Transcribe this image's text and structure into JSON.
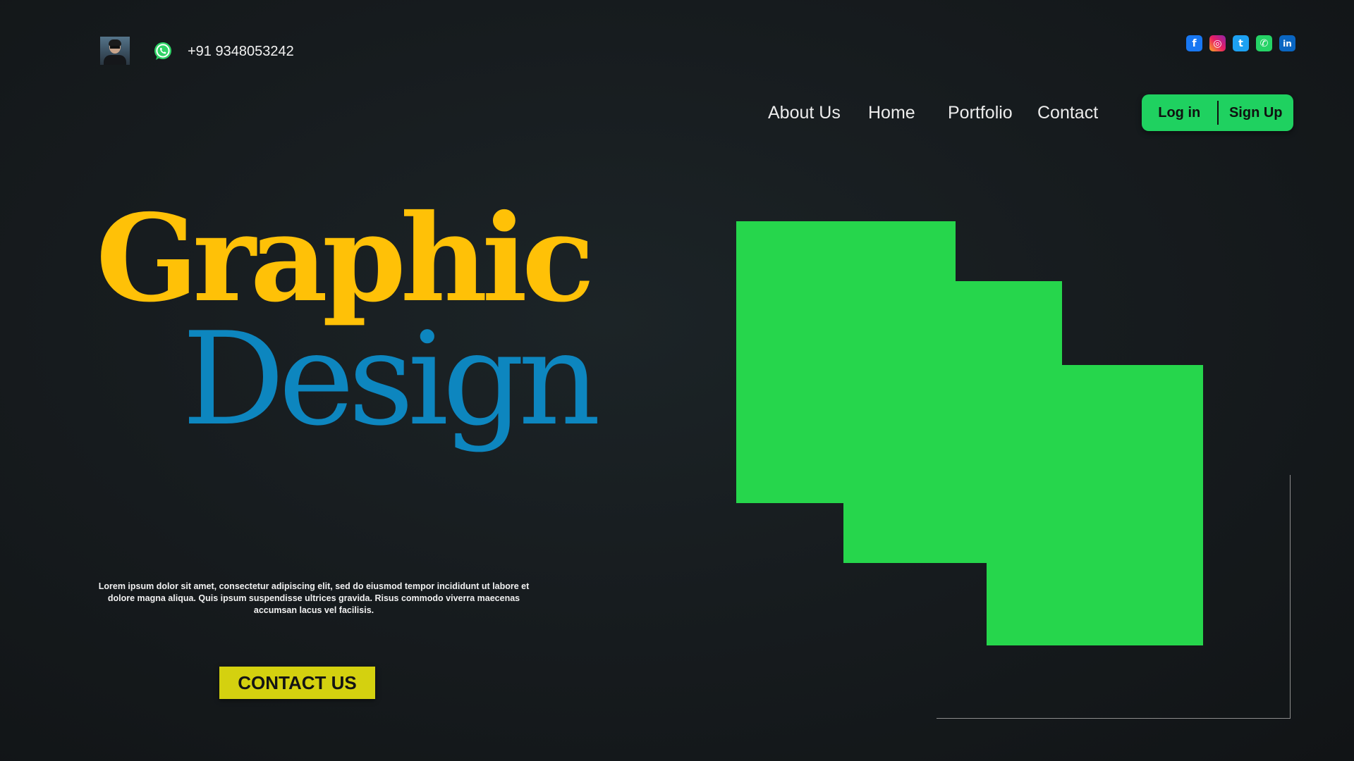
{
  "contact": {
    "phone": "+91 9348053242",
    "avatar_icon": "profile-photo",
    "whatsapp_icon": "whatsapp-icon"
  },
  "social": [
    {
      "name": "facebook-icon",
      "glyph": "f"
    },
    {
      "name": "instagram-icon",
      "glyph": "◎"
    },
    {
      "name": "twitter-icon",
      "glyph": "t"
    },
    {
      "name": "whatsapp-icon",
      "glyph": "✆"
    },
    {
      "name": "linkedin-icon",
      "glyph": "in"
    }
  ],
  "nav": {
    "about": "About Us",
    "home": "Home",
    "portfolio": "Portfolio",
    "contact": "Contact"
  },
  "auth": {
    "login": "Log in",
    "signup": "Sign Up"
  },
  "hero": {
    "title_line1": "Graphic",
    "title_line2": "Design",
    "description": "Lorem ipsum dolor sit amet, consectetur adipiscing elit, sed do eiusmod tempor incididunt ut labore et dolore magna aliqua. Quis ipsum suspendisse ultrices gravida. Risus commodo viverra maecenas accumsan lacus vel facilisis.",
    "cta": "CONTACT US"
  },
  "colors": {
    "background": "#171c1f",
    "accent_green": "#1fd160",
    "art_green": "#26d64c",
    "title_yellow": "#ffc107",
    "title_blue": "#0d86bf",
    "cta_yellow": "#d4d10f"
  }
}
